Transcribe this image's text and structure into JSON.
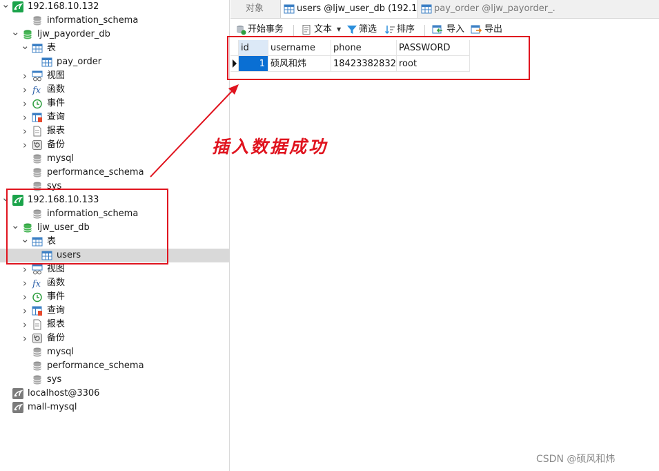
{
  "tree": [
    {
      "label": "192.168.10.132",
      "icon": "connection-icon",
      "arrow": "expanded",
      "indent": 0
    },
    {
      "label": "information_schema",
      "icon": "database-icon",
      "arrow": "none",
      "indent": 2
    },
    {
      "label": "ljw_payorder_db",
      "icon": "database-open-icon",
      "arrow": "expanded",
      "indent": 1
    },
    {
      "label": "表",
      "icon": "table-group-icon",
      "arrow": "expanded",
      "indent": 2
    },
    {
      "label": "pay_order",
      "icon": "table-icon",
      "arrow": "none",
      "indent": 3
    },
    {
      "label": "视图",
      "icon": "view-icon",
      "arrow": "collapsed",
      "indent": 2
    },
    {
      "label": "函数",
      "icon": "function-icon",
      "arrow": "collapsed",
      "indent": 2
    },
    {
      "label": "事件",
      "icon": "event-icon",
      "arrow": "collapsed",
      "indent": 2
    },
    {
      "label": "查询",
      "icon": "query-icon",
      "arrow": "collapsed",
      "indent": 2
    },
    {
      "label": "报表",
      "icon": "report-icon",
      "arrow": "collapsed",
      "indent": 2
    },
    {
      "label": "备份",
      "icon": "backup-icon",
      "arrow": "collapsed",
      "indent": 2
    },
    {
      "label": "mysql",
      "icon": "database-icon",
      "arrow": "none",
      "indent": 2
    },
    {
      "label": "performance_schema",
      "icon": "database-icon",
      "arrow": "none",
      "indent": 2
    },
    {
      "label": "sys",
      "icon": "database-icon",
      "arrow": "none",
      "indent": 2
    },
    {
      "label": "192.168.10.133",
      "icon": "connection-icon",
      "arrow": "expanded",
      "indent": 0
    },
    {
      "label": "information_schema",
      "icon": "database-icon",
      "arrow": "none",
      "indent": 2
    },
    {
      "label": "ljw_user_db",
      "icon": "database-open-icon",
      "arrow": "expanded",
      "indent": 1
    },
    {
      "label": "表",
      "icon": "table-group-icon",
      "arrow": "expanded",
      "indent": 2
    },
    {
      "label": "users",
      "icon": "table-icon",
      "arrow": "none",
      "indent": 3,
      "selected": true
    },
    {
      "label": "视图",
      "icon": "view-icon",
      "arrow": "collapsed",
      "indent": 2
    },
    {
      "label": "函数",
      "icon": "function-icon",
      "arrow": "collapsed",
      "indent": 2
    },
    {
      "label": "事件",
      "icon": "event-icon",
      "arrow": "collapsed",
      "indent": 2
    },
    {
      "label": "查询",
      "icon": "query-icon",
      "arrow": "collapsed",
      "indent": 2
    },
    {
      "label": "报表",
      "icon": "report-icon",
      "arrow": "collapsed",
      "indent": 2
    },
    {
      "label": "备份",
      "icon": "backup-icon",
      "arrow": "collapsed",
      "indent": 2
    },
    {
      "label": "mysql",
      "icon": "database-icon",
      "arrow": "none",
      "indent": 2
    },
    {
      "label": "performance_schema",
      "icon": "database-icon",
      "arrow": "none",
      "indent": 2
    },
    {
      "label": "sys",
      "icon": "database-icon",
      "arrow": "none",
      "indent": 2
    },
    {
      "label": "localhost@3306",
      "icon": "connection-off-icon",
      "arrow": "none",
      "indent": 0
    },
    {
      "label": "mall-mysql",
      "icon": "connection-off-icon",
      "arrow": "none",
      "indent": 0
    }
  ],
  "tabs": [
    {
      "label": "对象",
      "active": false,
      "icon": ""
    },
    {
      "label": "users @ljw_user_db (192.1...",
      "active": true,
      "icon": "table-icon"
    },
    {
      "label": "pay_order @ljw_payorder_...",
      "active": false,
      "icon": "table-icon"
    }
  ],
  "toolbar": {
    "begin_transaction": "开始事务",
    "text": "文本",
    "filter": "筛选",
    "sort": "排序",
    "import": "导入",
    "export": "导出"
  },
  "grid": {
    "columns": [
      "id",
      "username",
      "phone",
      "PASSWORD"
    ],
    "rows": [
      [
        "1",
        "硕风和炜",
        "18423382832",
        "root"
      ]
    ]
  },
  "annotation": "插入数据成功",
  "watermark": "CSDN @硕风和炜",
  "colors": {
    "annotation_red": "#e0141f",
    "selection_blue": "#0a6fd3",
    "db_green": "#2e9e3f",
    "connection_green": "#1aa34a"
  }
}
